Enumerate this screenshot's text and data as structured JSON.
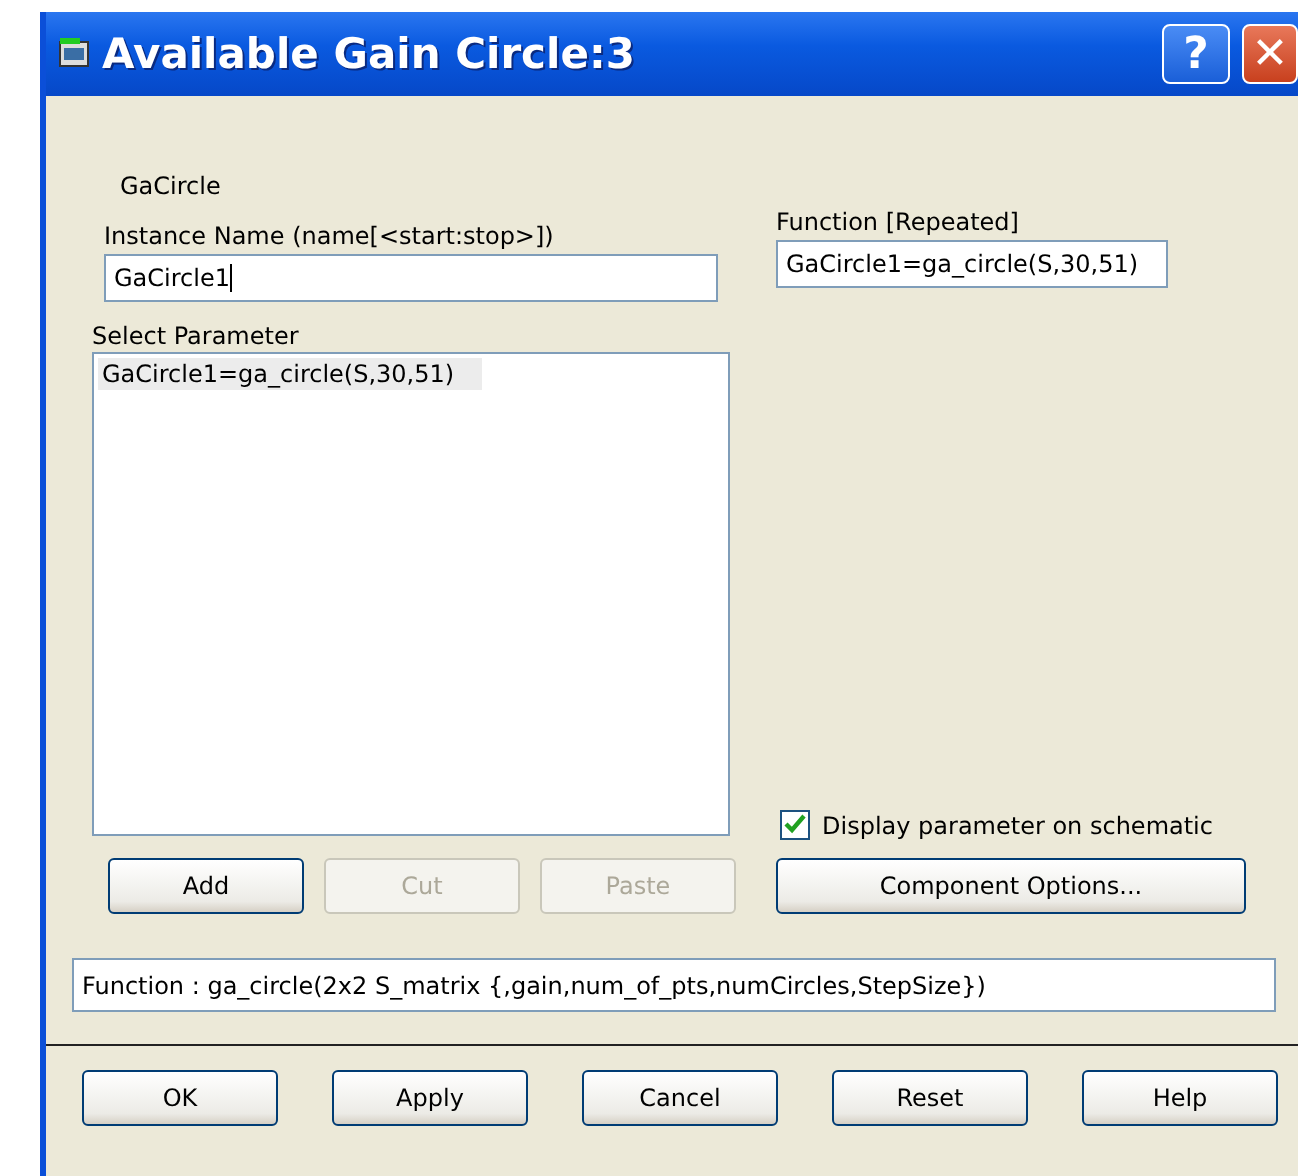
{
  "window": {
    "title": "Available Gain Circle:3",
    "title_buttons": [
      "?",
      "✕"
    ]
  },
  "component_label": "GaCircle",
  "instance_name": {
    "label": "Instance Name  (name[<start:stop>])",
    "value": "GaCircle1"
  },
  "select_parameter": {
    "label": "Select Parameter",
    "items": [
      {
        "text": "GaCircle1=ga_circle(S,30,51)",
        "selected": true
      }
    ]
  },
  "list_buttons": [
    {
      "label": "Add",
      "disabled": false
    },
    {
      "label": "Cut",
      "disabled": true
    },
    {
      "label": "Paste",
      "disabled": true
    }
  ],
  "function_repeated": {
    "label": "Function [Repeated]",
    "value": "GaCircle1=ga_circle(S,30,51)"
  },
  "display_on_schematic": {
    "label": "Display parameter on schematic",
    "checked": true
  },
  "component_options": "Component Options...",
  "function_signature": "Function : ga_circle(2x2 S_matrix {,gain,num_of_pts,numCircles,StepSize})",
  "dialog_buttons": [
    "OK",
    "Apply",
    "Cancel",
    "Reset",
    "Help"
  ]
}
